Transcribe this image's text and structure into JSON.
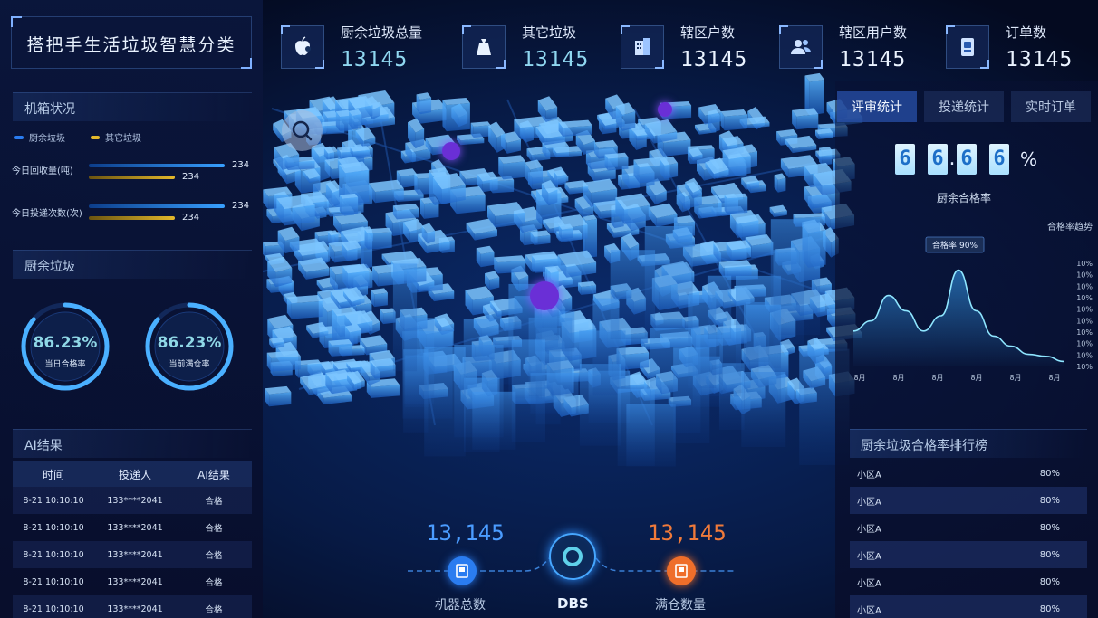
{
  "app": {
    "title": "搭把手生活垃圾智慧分类"
  },
  "stats": [
    {
      "label": "厨余垃圾总量",
      "value": "13145",
      "icon": "apple-icon"
    },
    {
      "label": "其它垃圾",
      "value": "13145",
      "icon": "trash-bag-icon"
    },
    {
      "label": "辖区户数",
      "value": "13145",
      "icon": "building-icon"
    },
    {
      "label": "辖区用户数",
      "value": "13145",
      "icon": "users-icon"
    },
    {
      "label": "订单数",
      "value": "13145",
      "icon": "order-icon"
    }
  ],
  "bin_status": {
    "title": "机箱状况",
    "legend": [
      "厨余垃圾",
      "其它垃圾"
    ],
    "rows": [
      {
        "label": "今日回收量(吨)",
        "blue": "234",
        "yellow": "234"
      },
      {
        "label": "今日投递次数(次)",
        "blue": "234",
        "yellow": "234"
      }
    ]
  },
  "kitchen": {
    "title": "厨余垃圾",
    "rings": [
      {
        "value": "86.23%",
        "caption": "当日合格率",
        "fraction": 0.8623
      },
      {
        "value": "86.23%",
        "caption": "当前满仓率",
        "fraction": 0.8623
      }
    ]
  },
  "ai": {
    "title": "AI结果",
    "columns": [
      "时间",
      "投递人",
      "AI结果"
    ],
    "rows": [
      [
        "8-21 10:10:10",
        "133****2041",
        "合格"
      ],
      [
        "8-21 10:10:10",
        "133****2041",
        "合格"
      ],
      [
        "8-21 10:10:10",
        "133****2041",
        "合格"
      ],
      [
        "8-21 10:10:10",
        "133****2041",
        "合格"
      ],
      [
        "8-21 10:10:10",
        "133****2041",
        "合格"
      ]
    ]
  },
  "tabs": [
    "评审统计",
    "投递统计",
    "实时订单"
  ],
  "rate": {
    "digits": [
      "6",
      "6",
      "6",
      "6"
    ],
    "dot": ".",
    "percent": "%",
    "caption": "厨余合格率"
  },
  "trend": {
    "title": "合格率趋势",
    "tooltip": "合格率:90%",
    "y_ticks": [
      "10%",
      "10%",
      "10%",
      "10%",
      "10%",
      "10%",
      "10%",
      "10%",
      "10%",
      "10%"
    ],
    "x_ticks": [
      "8月",
      "8月",
      "8月",
      "8月",
      "8月",
      "8月"
    ],
    "values": [
      0.35,
      0.45,
      0.7,
      0.55,
      0.35,
      0.5,
      0.95,
      0.55,
      0.3,
      0.2,
      0.12,
      0.1,
      0.05
    ]
  },
  "ranking": {
    "title": "厨余垃圾合格率排行榜",
    "rows": [
      [
        "小区A",
        "80%"
      ],
      [
        "小区A",
        "80%"
      ],
      [
        "小区A",
        "80%"
      ],
      [
        "小区A",
        "80%"
      ],
      [
        "小区A",
        "80%"
      ],
      [
        "小区A",
        "80%"
      ]
    ]
  },
  "bottom": {
    "left_value": "13,145",
    "left_label": "机器总数",
    "center_label": "DBS",
    "right_value": "13,145",
    "right_label": "满仓数量"
  },
  "colors": {
    "accent_blue": "#2a7cf0",
    "accent_orange": "#ef6e2a",
    "accent_yellow": "#e3b82b",
    "cyan": "#5fd1ea"
  }
}
